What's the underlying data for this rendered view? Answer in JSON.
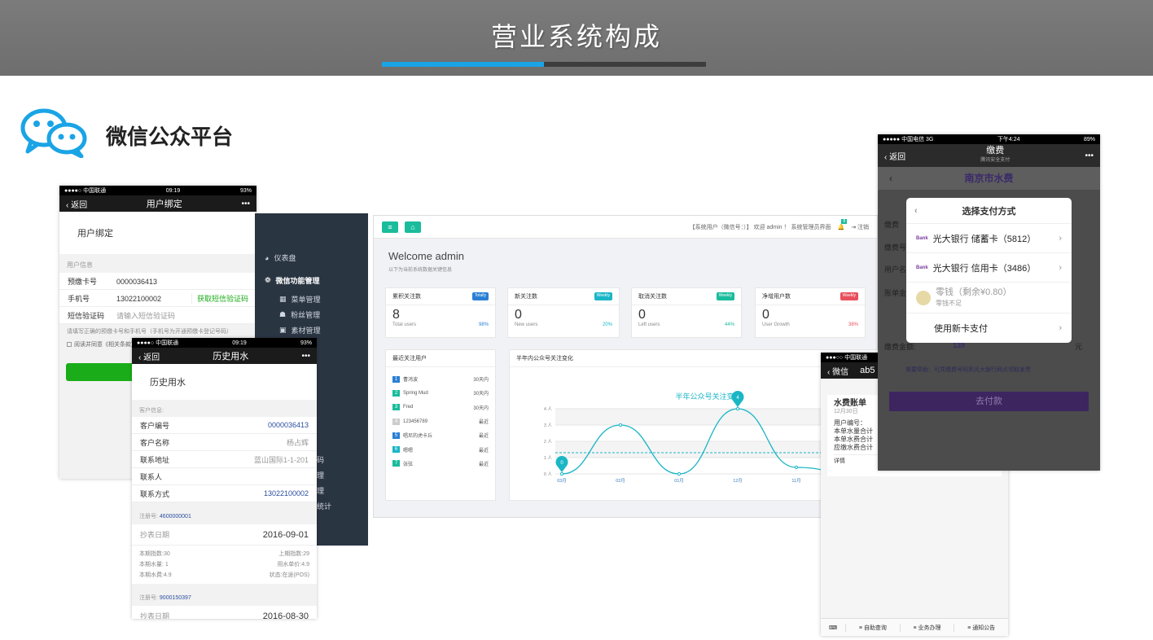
{
  "banner": {
    "title": "营业系统构成"
  },
  "section": {
    "title": "微信公众平台",
    "icon": "wechat-icon"
  },
  "colors": {
    "accent": "#1aa4e6",
    "wechat_green": "#1aad19",
    "teal": "#1abc9c",
    "purple": "#6a1b9a"
  },
  "phone1": {
    "status": {
      "carrier": "●●●●○ 中国联通",
      "time": "09:19",
      "battery": "93%"
    },
    "nav": {
      "back": "返回",
      "title": "用户绑定"
    },
    "heading": "用户绑定",
    "section_label": "用户信息",
    "rows": [
      {
        "label": "预缴卡号",
        "value": "0000036413"
      },
      {
        "label": "手机号",
        "value": "13022100002",
        "action": "获取短信验证码"
      },
      {
        "label": "短信验证码",
        "placeholder": "请输入短信验证码"
      }
    ],
    "hint": "请填写正确的预缴卡号和手机号（手机号为开通预缴卡登记号码）",
    "agree": "阅读并同意《相关条款》"
  },
  "phone2": {
    "status": {
      "carrier": "●●●●○ 中国联通",
      "time": "09:19",
      "battery": "93%"
    },
    "nav": {
      "back": "返回",
      "title": "历史用水"
    },
    "heading": "历史用水",
    "section_label": "客户信息:",
    "rows": [
      {
        "label": "客户编号",
        "value": "0000036413"
      },
      {
        "label": "客户名称",
        "value": "杨占辉"
      },
      {
        "label": "联系地址",
        "value": "蓝山国际1-1-201"
      },
      {
        "label": "联系人",
        "value": ""
      },
      {
        "label": "联系方式",
        "value": "13022100002"
      }
    ],
    "records": [
      {
        "reg_label": "注册号:",
        "reg_no": "4600000001",
        "date_label": "抄表日期",
        "date": "2016-09-01",
        "details": [
          [
            "本期指数:30",
            "上期指数:29"
          ],
          [
            "本期水量: 1",
            "用水单价:4.9"
          ],
          [
            "本期水费:4.9",
            "状态:在途(POS)"
          ]
        ]
      },
      {
        "reg_label": "注册号:",
        "reg_no": "9000150397",
        "date_label": "抄表日期",
        "date": "2016-08-30"
      }
    ]
  },
  "admin": {
    "sidebar": [
      {
        "label": "仪表盘",
        "icon": "dashboard-icon"
      },
      {
        "label": "微信功能管理",
        "icon": "wechat-small-icon"
      },
      {
        "label": "菜单管理",
        "icon": "grid-icon"
      },
      {
        "label": "粉丝管理",
        "icon": "users-icon"
      },
      {
        "label": "素材管理",
        "icon": "image-icon"
      }
    ],
    "sidebar_partial": [
      "码",
      "理",
      "理",
      "统计"
    ],
    "top_right": "【系统用户（微信号：）】  欢迎 admin ！   系统管理员界面",
    "notif_count": "8",
    "logout": "注销",
    "welcome": "Welcome admin",
    "welcome_sub": "以下为当前系统数据关键信息",
    "stats": [
      {
        "title": "累积关注数",
        "badge": "Totally",
        "value": "8",
        "caption": "Total users",
        "pct": "98%",
        "color": "#2a7fd4"
      },
      {
        "title": "新关注数",
        "badge": "Weekly",
        "value": "0",
        "caption": "New users",
        "pct": "20%",
        "color": "#1ab6c6"
      },
      {
        "title": "取消关注数",
        "badge": "Weekly",
        "value": "0",
        "caption": "Left users",
        "pct": "44%",
        "color": "#1abc9c"
      },
      {
        "title": "净增用户数",
        "badge": "Weekly",
        "value": "0",
        "caption": "User Growth",
        "pct": "38%",
        "color": "#e94f5c"
      }
    ],
    "recent_title": "最近关注用户",
    "recent": [
      {
        "n": "1",
        "name": "曹鸿波",
        "time": "30天内",
        "color": "#2a7fd4"
      },
      {
        "n": "2",
        "name": "Spring Mud",
        "time": "30天内",
        "color": "#1abc9c"
      },
      {
        "n": "3",
        "name": "Fred",
        "time": "30天内",
        "color": "#1abc9c"
      },
      {
        "n": "4",
        "name": "123456789",
        "time": "最近",
        "color": "#cccccc"
      },
      {
        "n": "5",
        "name": "唱尼的虎卡丘",
        "time": "最近",
        "color": "#2a7fd4"
      },
      {
        "n": "6",
        "name": "嗯嗯",
        "time": "最近",
        "color": "#1ab6c6"
      },
      {
        "n": "7",
        "name": "张弦",
        "time": "最近",
        "color": "#1abc9c"
      }
    ],
    "chart_card_title": "半年内公众号关注变化"
  },
  "chart_data": {
    "type": "line",
    "title": "半年公众号关注变化",
    "categories": [
      "03月",
      "02月",
      "01月",
      "12月",
      "11月",
      "10月"
    ],
    "values": [
      0,
      3,
      0,
      4,
      0.4,
      0
    ],
    "y_ticks": [
      "0 人",
      "1 人",
      "2 人",
      "3 人",
      "4 人"
    ],
    "ylim": [
      0,
      4
    ],
    "markers": [
      {
        "index": 0,
        "label": "0"
      },
      {
        "index": 3,
        "label": "4"
      }
    ],
    "avg_line": 1.3,
    "color": "#1ab6c6"
  },
  "phone3": {
    "status": {
      "carrier": "●●●○○ 中国联通"
    },
    "nav": {
      "back": "微信",
      "title": "ab5"
    },
    "bill_title": "水费账单",
    "bill_date": "12月30日",
    "lines": [
      "用户编号：",
      "本单水量合计",
      "本单水费合计",
      "应缴水费合计"
    ],
    "detail": "详情",
    "tabs": [
      "自助查询",
      "业务办理",
      "通知公告"
    ]
  },
  "phone4": {
    "status": {
      "carrier": "●●●●● 中国电信 3G",
      "time": "下午4:24",
      "battery": "89%"
    },
    "nav": {
      "back": "返回",
      "title": "缴费",
      "subtitle": "腾讯安全支付"
    },
    "city": "南京市水费",
    "rows": [
      "缴费",
      "缴费号",
      "用户名",
      "账单金"
    ],
    "amount_label": "缴费金额:",
    "amount": "139",
    "unit": "元",
    "notice": "需要帮助：可凭缴费号码到光大银行网点领取发票",
    "pay_button": "去付款",
    "modal": {
      "title": "选择支付方式",
      "options": [
        {
          "label": "光大银行 储蓄卡（5812）",
          "icon": "bank-icon"
        },
        {
          "label": "光大银行 信用卡（3486）",
          "icon": "bank-icon"
        },
        {
          "label": "零钱（剩余¥0.80）",
          "sub": "零钱不足",
          "icon": "coin-icon"
        },
        {
          "label": "使用新卡支付",
          "icon": ""
        }
      ]
    }
  }
}
